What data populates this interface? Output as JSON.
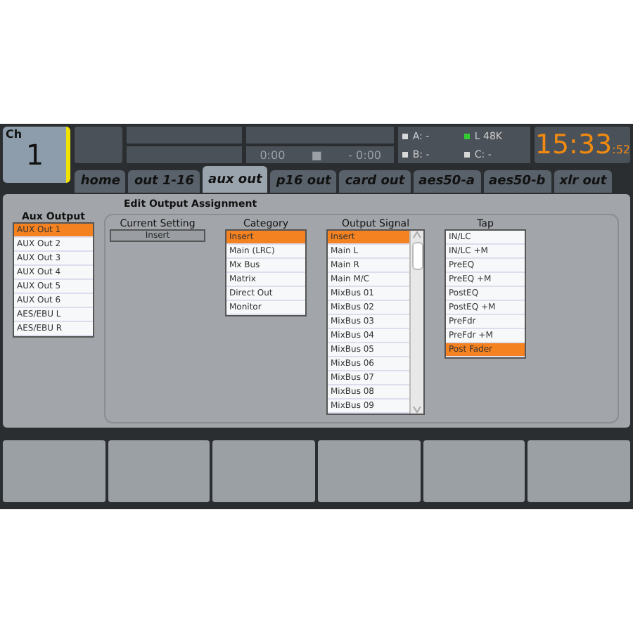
{
  "channel": {
    "label": "Ch",
    "number": "1"
  },
  "transport": {
    "time": "0:00",
    "stop": "■",
    "remaining": "- 0:00"
  },
  "indicators": [
    {
      "text": "A: -",
      "color": "#d8d8d8"
    },
    {
      "text": "L 48K",
      "color": "#33cc33"
    },
    {
      "text": "B: -",
      "color": "#d8d8d8"
    },
    {
      "text": "C: -",
      "color": "#d8d8d8"
    }
  ],
  "clock": {
    "time": "15:33",
    "seconds": ":52"
  },
  "tabs": [
    {
      "label": "home",
      "selected": false
    },
    {
      "label": "out 1-16",
      "selected": false
    },
    {
      "label": "aux out",
      "selected": true
    },
    {
      "label": "p16 out",
      "selected": false
    },
    {
      "label": "card out",
      "selected": false
    },
    {
      "label": "aes50-a",
      "selected": false
    },
    {
      "label": "aes50-b",
      "selected": false
    },
    {
      "label": "xlr out",
      "selected": false
    }
  ],
  "title": "Edit Output Assignment",
  "aux_output": {
    "title": "Aux Output",
    "items": [
      {
        "label": "AUX Out 1",
        "selected": true
      },
      {
        "label": "AUX Out 2",
        "selected": false
      },
      {
        "label": "AUX Out 3",
        "selected": false
      },
      {
        "label": "AUX Out 4",
        "selected": false
      },
      {
        "label": "AUX Out 5",
        "selected": false
      },
      {
        "label": "AUX Out 6",
        "selected": false
      },
      {
        "label": "AES/EBU L",
        "selected": false
      },
      {
        "label": "AES/EBU R",
        "selected": false
      }
    ]
  },
  "current_setting": {
    "title": "Current Setting",
    "value": "Insert"
  },
  "category": {
    "title": "Category",
    "items": [
      {
        "label": "Insert",
        "selected": true
      },
      {
        "label": "Main (LRC)",
        "selected": false
      },
      {
        "label": "Mx Bus",
        "selected": false
      },
      {
        "label": "Matrix",
        "selected": false
      },
      {
        "label": "Direct Out",
        "selected": false
      },
      {
        "label": "Monitor",
        "selected": false
      }
    ]
  },
  "output_signal": {
    "title": "Output Signal",
    "items": [
      {
        "label": "Insert",
        "selected": true
      },
      {
        "label": "Main L",
        "selected": false
      },
      {
        "label": "Main R",
        "selected": false
      },
      {
        "label": "Main M/C",
        "selected": false
      },
      {
        "label": "MixBus 01",
        "selected": false
      },
      {
        "label": "MixBus 02",
        "selected": false
      },
      {
        "label": "MixBus 03",
        "selected": false
      },
      {
        "label": "MixBus 04",
        "selected": false
      },
      {
        "label": "MixBus 05",
        "selected": false
      },
      {
        "label": "MixBus 06",
        "selected": false
      },
      {
        "label": "MixBus 07",
        "selected": false
      },
      {
        "label": "MixBus 08",
        "selected": false
      },
      {
        "label": "MixBus 09",
        "selected": false
      }
    ]
  },
  "tap": {
    "title": "Tap",
    "items": [
      {
        "label": "IN/LC",
        "selected": false
      },
      {
        "label": "IN/LC +M",
        "selected": false
      },
      {
        "label": "PreEQ",
        "selected": false
      },
      {
        "label": "PreEQ +M",
        "selected": false
      },
      {
        "label": "PostEQ",
        "selected": false
      },
      {
        "label": "PostEQ +M",
        "selected": false
      },
      {
        "label": "PreFdr",
        "selected": false
      },
      {
        "label": "PreFdr +M",
        "selected": false
      },
      {
        "label": "Post Fader",
        "selected": true
      }
    ]
  }
}
